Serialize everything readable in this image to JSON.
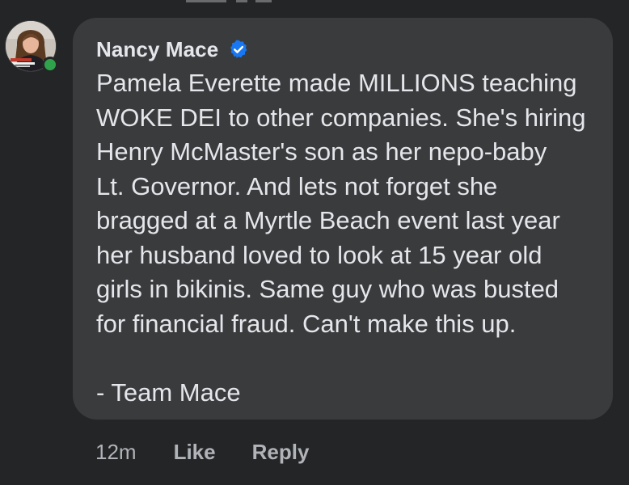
{
  "comment": {
    "author": "Nancy Mace",
    "verified": true,
    "body": "Pamela Everette made MILLIONS teaching\nWOKE DEI to other companies. She's hiring\nHenry McMaster's son as her nepo-baby\nLt. Governor. And lets not forget she\nbragged at a Myrtle Beach event last year\nher husband loved to look at 15 year old\ngirls in bikinis. Same guy who was busted\nfor financial fraud. Can't make this up.\n\n- Team Mace",
    "timestamp": "12m",
    "online": true
  },
  "actions": {
    "like_label": "Like",
    "reply_label": "Reply"
  },
  "icons": {
    "verified": "verified-badge-icon",
    "online": "online-status-icon"
  },
  "colors": {
    "background": "#242526",
    "bubble": "#3a3b3c",
    "text_primary": "#e4e6eb",
    "text_secondary": "#b0b3b8",
    "verified_blue": "#1877f2",
    "online_green": "#31a24c"
  }
}
